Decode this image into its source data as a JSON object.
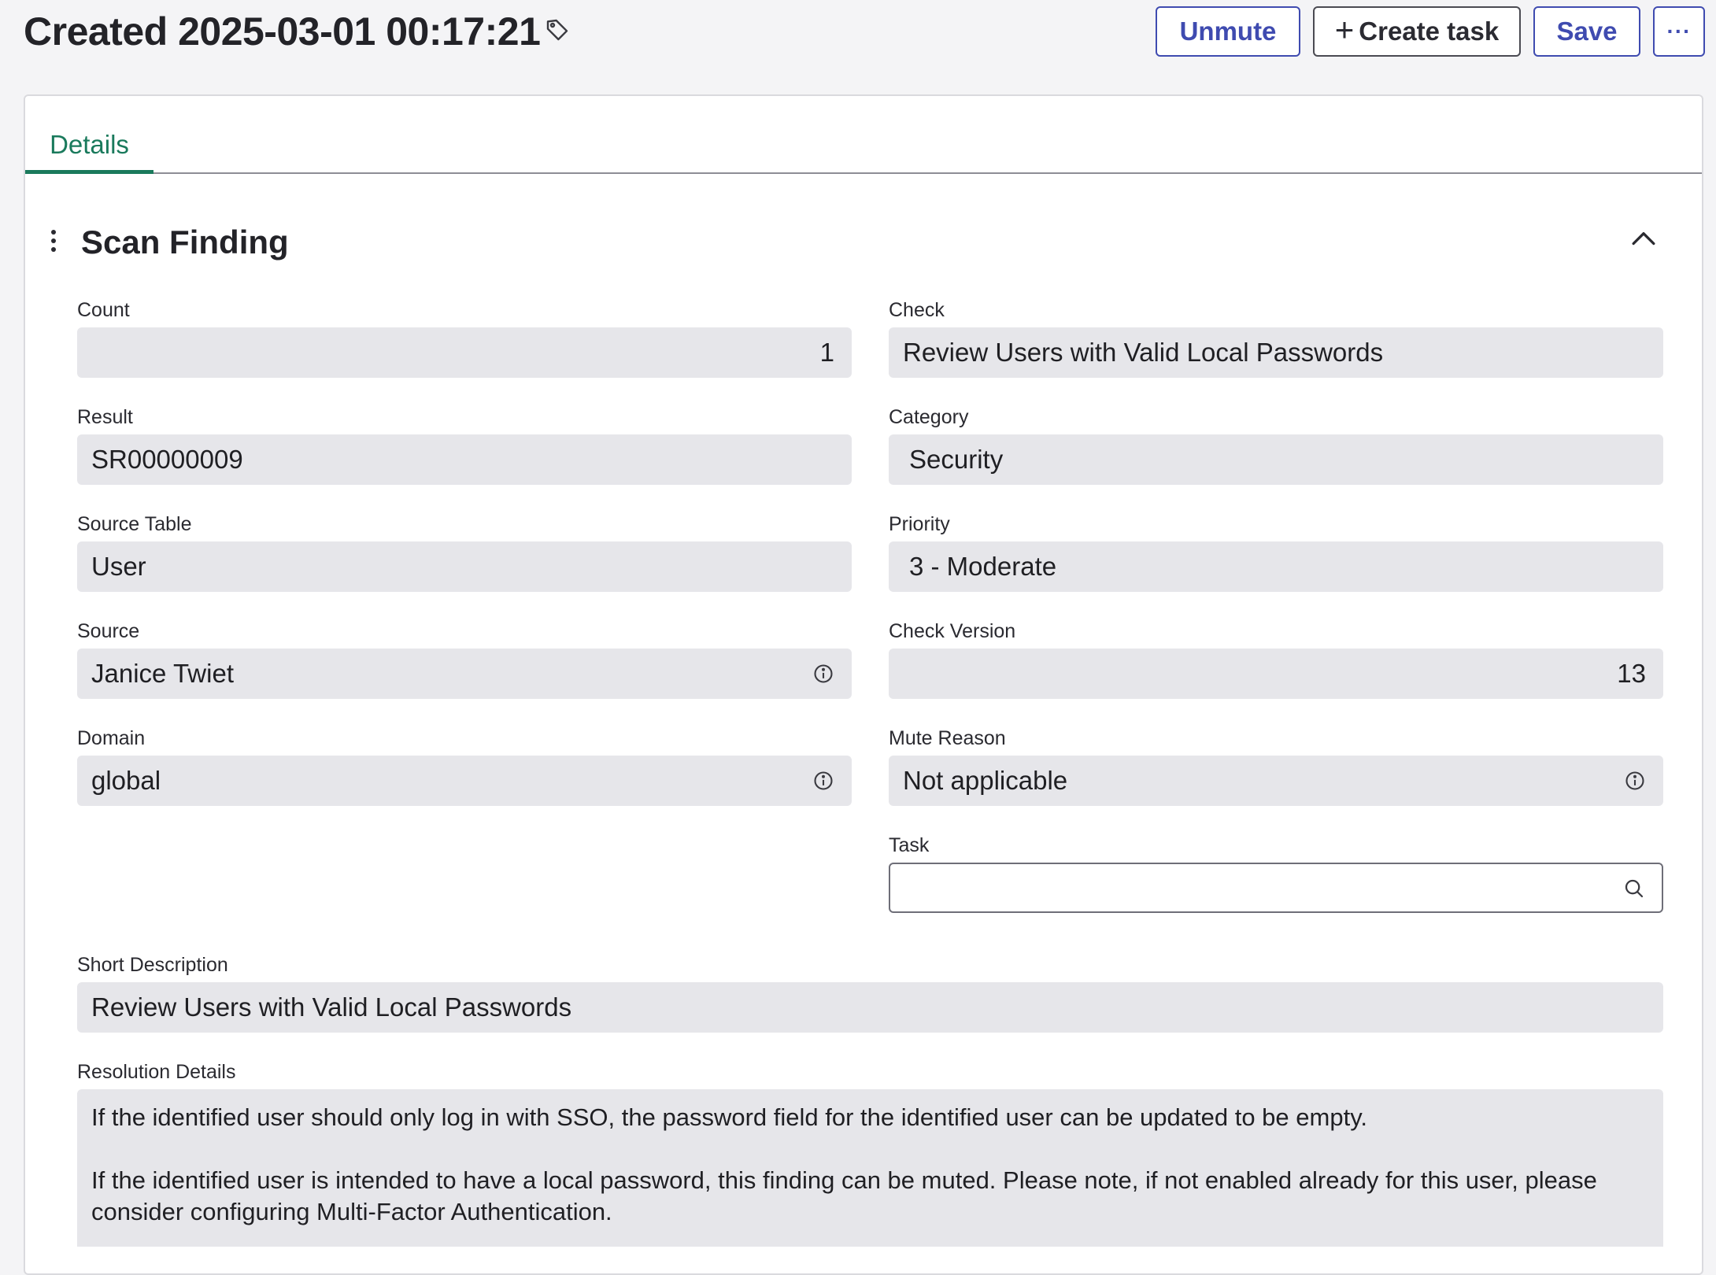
{
  "header": {
    "title": "Created 2025-03-01 00:17:21",
    "unmute_label": "Unmute",
    "create_task_label": "Create task",
    "save_label": "Save",
    "more_label": "···"
  },
  "tabs": [
    {
      "label": "Details",
      "selected": true
    }
  ],
  "section": {
    "title": "Scan Finding",
    "fields": {
      "count": {
        "label": "Count",
        "value": "1"
      },
      "check": {
        "label": "Check",
        "value": "Review Users with Valid Local Passwords"
      },
      "result": {
        "label": "Result",
        "value": "SR00000009"
      },
      "category": {
        "label": "Category",
        "value": "Security"
      },
      "source_table": {
        "label": "Source Table",
        "value": "User"
      },
      "priority": {
        "label": "Priority",
        "value": "3 - Moderate"
      },
      "source": {
        "label": "Source",
        "value": "Janice Twiet"
      },
      "check_version": {
        "label": "Check Version",
        "value": "13"
      },
      "domain": {
        "label": "Domain",
        "value": "global"
      },
      "mute_reason": {
        "label": "Mute Reason",
        "value": "Not applicable"
      },
      "task": {
        "label": "Task",
        "value": ""
      },
      "short_description": {
        "label": "Short Description",
        "value": "Review Users with Valid Local Passwords"
      },
      "resolution_details": {
        "label": "Resolution Details",
        "paragraph1": "If the identified user should only log in with SSO, the password field for the identified user can be updated to be empty.",
        "paragraph2": "If the identified user is intended to have a local password, this finding can be muted. Please note, if not enabled already for this user, please consider configuring Multi-Factor Authentication."
      }
    }
  },
  "colors": {
    "primary": "#3f4bb0",
    "tab_active": "#1a7a5c",
    "field_bg": "#e6e6ea",
    "page_bg": "#f4f4f6"
  },
  "icons": [
    "tag-icon",
    "plus-icon",
    "more-icon",
    "drag-handle-icon",
    "chevron-up-icon",
    "info-icon",
    "search-icon"
  ]
}
